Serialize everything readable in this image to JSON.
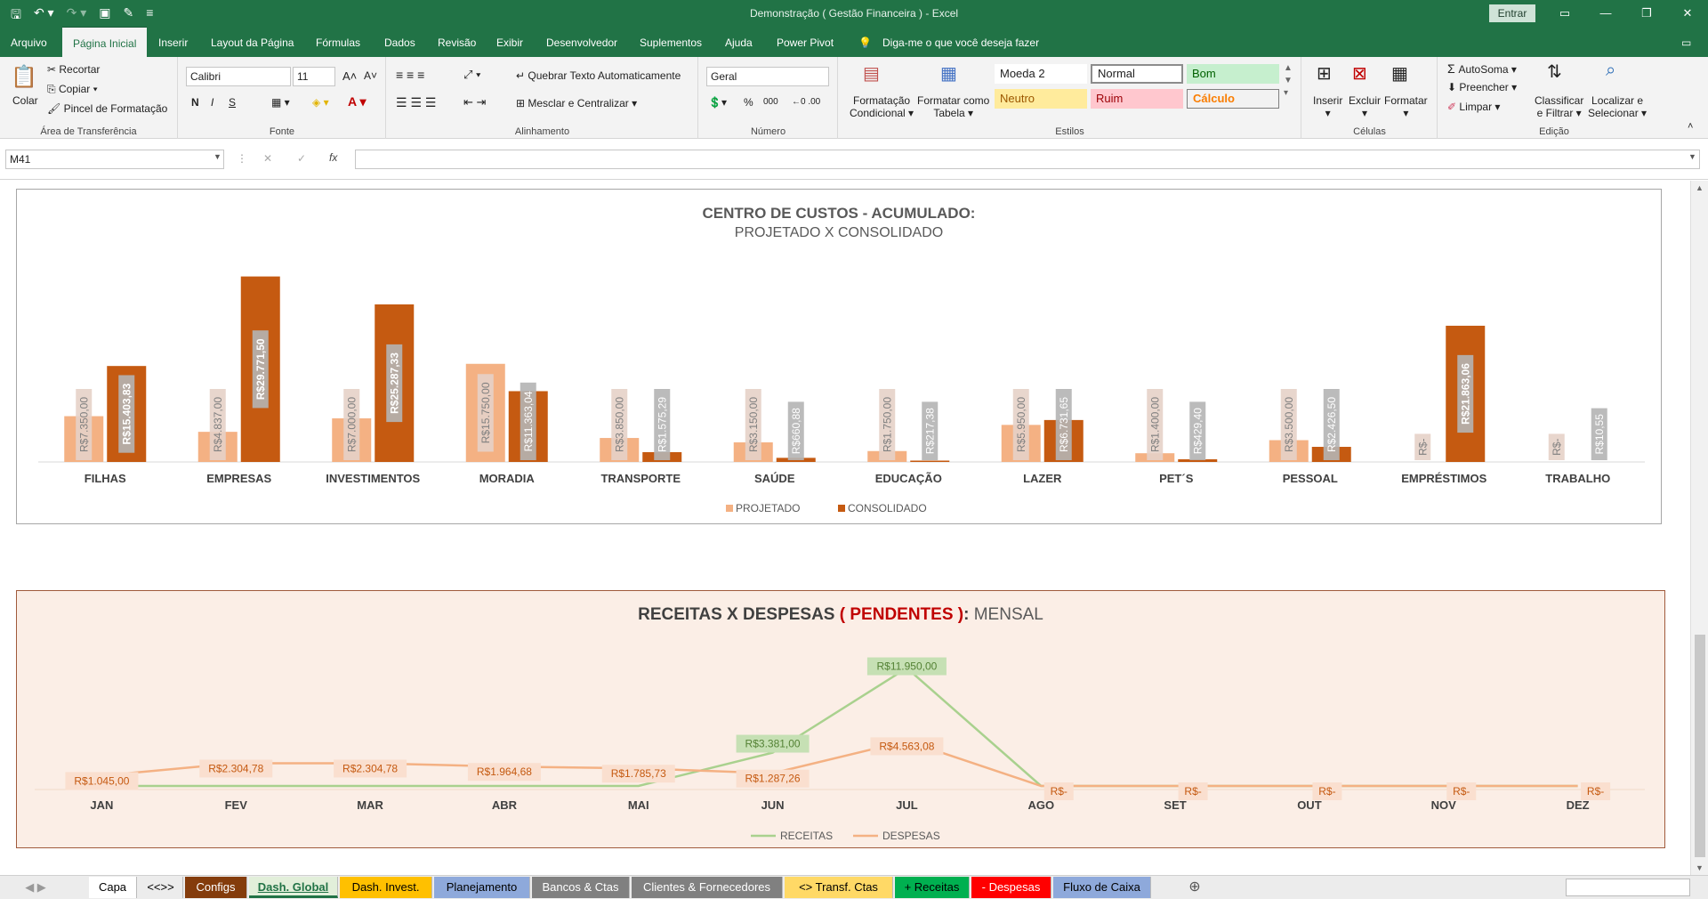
{
  "window": {
    "title": "Demonstração ( Gestão Financeira ) - Excel",
    "signin": "Entrar"
  },
  "qat_icons": [
    "save-icon",
    "undo-icon",
    "redo-icon",
    "camera-icon",
    "eraser-icon",
    "customize-icon"
  ],
  "menu_tabs": [
    "Arquivo",
    "Página Inicial",
    "Inserir",
    "Layout da Página",
    "Fórmulas",
    "Dados",
    "Revisão",
    "Exibir",
    "Desenvolvedor",
    "Suplementos",
    "Ajuda",
    "Power Pivot"
  ],
  "active_tab": "Página Inicial",
  "tell_me": "Diga-me o que você deseja fazer",
  "ribbon": {
    "clipboard": {
      "label": "Área de Transferência",
      "paste": "Colar",
      "cut": "Recortar",
      "copy": "Copiar",
      "format_painter": "Pincel de Formatação"
    },
    "font": {
      "label": "Fonte",
      "name": "Calibri",
      "size": "11",
      "bold": "N",
      "italic": "I",
      "underline": "S"
    },
    "alignment": {
      "label": "Alinhamento",
      "wrap": "Quebrar Texto Automaticamente",
      "merge": "Mesclar e Centralizar"
    },
    "number": {
      "label": "Número",
      "format": "Geral",
      "percent": "%",
      "thousands": "000"
    },
    "styles": {
      "label": "Estilos",
      "cond_format": [
        "Formatação",
        "Condicional"
      ],
      "format_table": [
        "Formatar como",
        "Tabela"
      ],
      "cells": [
        "Moeda 2",
        "Normal",
        "Bom",
        "Neutro",
        "Ruim",
        "Cálculo"
      ]
    },
    "cells": {
      "label": "Células",
      "insert": "Inserir",
      "delete": "Excluir",
      "format": "Formatar"
    },
    "editing": {
      "label": "Edição",
      "autosum": "AutoSoma",
      "fill": "Preencher",
      "clear": "Limpar",
      "sort": [
        "Classificar",
        "e Filtrar"
      ],
      "find": [
        "Localizar e",
        "Selecionar"
      ]
    }
  },
  "formula_bar": {
    "name_box": "M41",
    "fx": "fx",
    "value": ""
  },
  "chart_data": [
    {
      "type": "bar",
      "title": "CENTRO DE CUSTOS - ACUMULADO:",
      "subtitle": "PROJETADO X CONSOLIDADO",
      "categories": [
        "FILHAS",
        "EMPRESAS",
        "INVESTIMENTOS",
        "MORADIA",
        "TRANSPORTE",
        "SAÚDE",
        "EDUCAÇÃO",
        "LAZER",
        "PET´S",
        "PESSOAL",
        "EMPRÉSTIMOS",
        "TRABALHO"
      ],
      "series": [
        {
          "name": "PROJETADO",
          "color": "#f4b183",
          "values": [
            7350,
            4837,
            7000,
            15750,
            3850,
            3150,
            1750,
            5950,
            1400,
            3500,
            0,
            0
          ],
          "labels": [
            "R$7.350,00",
            "R$4.837,00",
            "R$7.000,00",
            "R$15.750,00",
            "R$3.850,00",
            "R$3.150,00",
            "R$1.750,00",
            "R$5.950,00",
            "R$1.400,00",
            "R$3.500,00",
            "R$-",
            "R$-"
          ]
        },
        {
          "name": "CONSOLIDADO",
          "color": "#c55a11",
          "values": [
            15403.83,
            29771.5,
            25287.33,
            11363.04,
            1575.29,
            660.88,
            217.38,
            6731.65,
            429.4,
            2426.5,
            21863.06,
            10.55
          ],
          "labels": [
            "R$15.403,83",
            "R$29.771,50",
            "R$25.287,33",
            "R$11.363,04",
            "R$1.575,29",
            "R$660,88",
            "R$217,38",
            "R$6.731,65",
            "R$429,40",
            "R$2.426,50",
            "R$21.863,06",
            "R$10,55"
          ]
        }
      ],
      "ylim": [
        0,
        30000
      ],
      "legend": "bottom"
    },
    {
      "type": "line",
      "title_parts": [
        "RECEITAS X DESPESAS ",
        "( PENDENTES )",
        ":",
        " MENSAL"
      ],
      "categories": [
        "JAN",
        "FEV",
        "MAR",
        "ABR",
        "MAI",
        "JUN",
        "JUL",
        "AGO",
        "SET",
        "OUT",
        "NOV",
        "DEZ"
      ],
      "series": [
        {
          "name": "RECEITAS",
          "color": "#a9d18e",
          "values": [
            0,
            0,
            0,
            0,
            0,
            3381,
            11950,
            0,
            0,
            0,
            0,
            0
          ],
          "labels": [
            "",
            "",
            "",
            "",
            "",
            "R$3.381,00",
            "R$11.950,00",
            "",
            "",
            "",
            "",
            ""
          ]
        },
        {
          "name": "DESPESAS",
          "color": "#f4b183",
          "values": [
            1045,
            2304.78,
            2304.78,
            1964.68,
            1785.73,
            1287.26,
            4563.08,
            0,
            0,
            0,
            0,
            0
          ],
          "labels": [
            "R$1.045,00",
            "R$2.304,78",
            "R$2.304,78",
            "R$1.964,68",
            "R$1.785,73",
            "R$1.287,26",
            "R$4.563,08",
            "R$-",
            "R$-",
            "R$-",
            "R$-",
            "R$-"
          ]
        }
      ],
      "ylim": [
        0,
        12000
      ],
      "legend": "bottom"
    }
  ],
  "sheet_tabs": [
    {
      "label": "Capa",
      "bg": "#ffffff",
      "fg": "#000000"
    },
    {
      "label": "<<>>",
      "bg": "#ececec",
      "fg": "#000000"
    },
    {
      "label": "Configs",
      "bg": "#843c0c",
      "fg": "#ffffff"
    },
    {
      "label": "Dash. Global",
      "bg": "#e2efda",
      "fg": "#217346",
      "active": true
    },
    {
      "label": "Dash. Invest.",
      "bg": "#ffc000",
      "fg": "#000000"
    },
    {
      "label": "Planejamento",
      "bg": "#8ea9db",
      "fg": "#000000"
    },
    {
      "label": "Bancos & Ctas",
      "bg": "#808080",
      "fg": "#ffffff"
    },
    {
      "label": "Clientes & Fornecedores",
      "bg": "#808080",
      "fg": "#ffffff"
    },
    {
      "label": "<> Transf. Ctas",
      "bg": "#ffd966",
      "fg": "#000000"
    },
    {
      "label": "+ Receitas",
      "bg": "#00b050",
      "fg": "#000000"
    },
    {
      "label": "- Despesas",
      "bg": "#ff0000",
      "fg": "#ffffff"
    },
    {
      "label": "Fluxo de Caixa",
      "bg": "#8ea9db",
      "fg": "#000000"
    }
  ]
}
